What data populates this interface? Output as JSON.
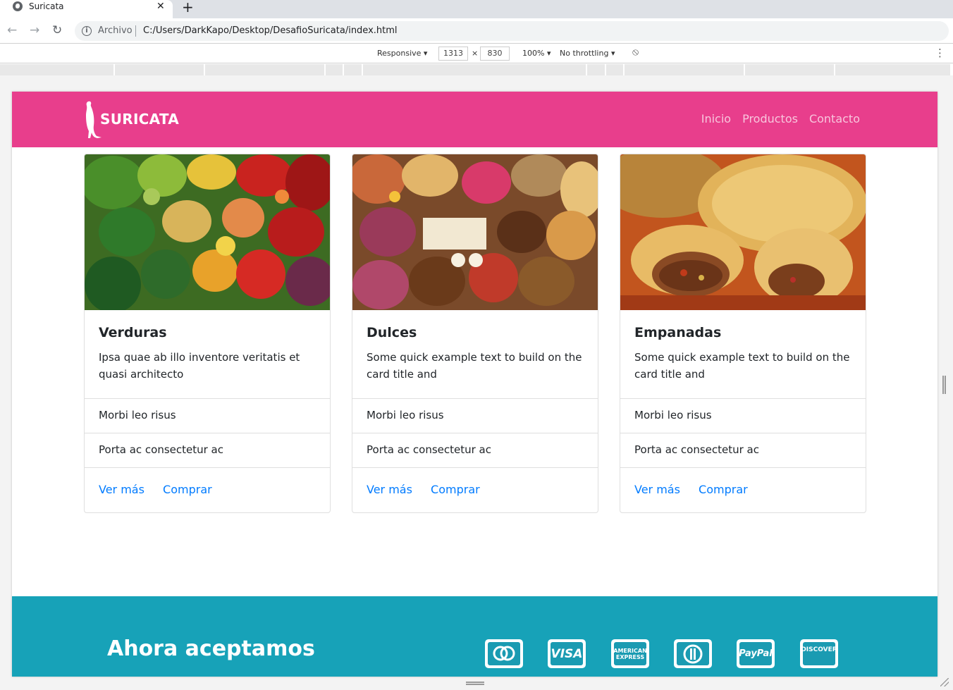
{
  "browser": {
    "tab_title": "Suricata",
    "close_glyph": "✕",
    "new_tab_glyph": "+",
    "back_glyph": "←",
    "forward_glyph": "→",
    "reload_glyph": "↻",
    "info_glyph": "i",
    "scheme_label": "Archivo",
    "url": "C:/Users/DarkKapo/Desktop/DesafioSuricata/index.html"
  },
  "devtools": {
    "mode": "Responsive ▾",
    "width": "1313",
    "times": "×",
    "height": "830",
    "zoom": "100% ▾",
    "throttling": "No throttling ▾",
    "rotate_glyph": "⃠",
    "more_glyph": "⋮"
  },
  "site": {
    "brand": "SURICATA",
    "nav": [
      "Inicio",
      "Productos",
      "Contacto"
    ],
    "cards": [
      {
        "title": "Verduras",
        "text": "Ipsa quae ab illo inventore veritatis et quasi architecto",
        "items": [
          "Morbi leo risus",
          "Porta ac consectetur ac"
        ],
        "links": [
          "Ver más",
          "Comprar"
        ],
        "image": "vegetables-photo"
      },
      {
        "title": "Dulces",
        "text": "Some quick example text to build on the card title and",
        "items": [
          "Morbi leo risus",
          "Porta ac consectetur ac"
        ],
        "links": [
          "Ver más",
          "Comprar"
        ],
        "image": "sweets-photo"
      },
      {
        "title": "Empanadas",
        "text": "Some quick example text to build on the card title and",
        "items": [
          "Morbi leo risus",
          "Porta ac consectetur ac"
        ],
        "links": [
          "Ver más",
          "Comprar"
        ],
        "image": "empanadas-photo"
      }
    ],
    "footer_title": "Ahora aceptamos",
    "payments": [
      {
        "name": "mastercard",
        "label": "mastercard",
        "color": "#1a9bb2"
      },
      {
        "name": "visa",
        "label": "VISA",
        "color": "#1a9bb2"
      },
      {
        "name": "american-express",
        "label": "AMERICAN EXPRESS",
        "color": "#1a9bb2"
      },
      {
        "name": "diners-club",
        "label": "",
        "color": "#1a9bb2"
      },
      {
        "name": "paypal",
        "label": "PayPal",
        "color": "#1a9bb2"
      },
      {
        "name": "discover",
        "label": "DISCOVER",
        "color": "#1a9bb2"
      }
    ]
  },
  "colors": {
    "header": "#e83e8c",
    "footer": "#17a2b8",
    "link": "#007bff"
  }
}
